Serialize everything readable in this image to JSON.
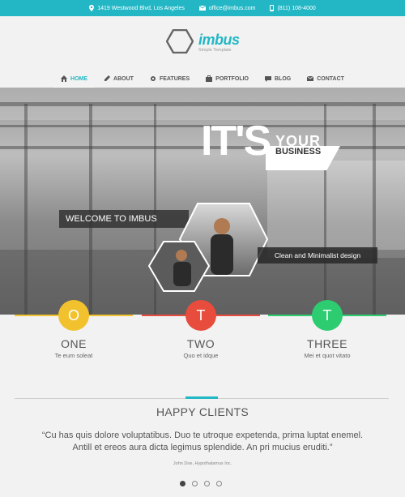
{
  "topbar": {
    "address": "1419 Westwood Blvd, Los Angeles",
    "email": "office@imbus.com",
    "phone": "(811) 108-4000"
  },
  "logo": {
    "title": "imbus",
    "subtitle": "Simple Template"
  },
  "nav": {
    "items": [
      {
        "label": "HOME",
        "icon": "home-icon"
      },
      {
        "label": "ABOUT",
        "icon": "pencil-icon"
      },
      {
        "label": "FEATURES",
        "icon": "gear-icon"
      },
      {
        "label": "PORTFOLIO",
        "icon": "briefcase-icon"
      },
      {
        "label": "BLOG",
        "icon": "comment-icon"
      },
      {
        "label": "CONTACT",
        "icon": "envelope-icon"
      }
    ]
  },
  "hero": {
    "title": "IT'S",
    "your": "YOUR",
    "business": "BUSINESS",
    "welcome": "WELCOME TO IMBUS",
    "tagline": "Clean and Minimalist design"
  },
  "features": [
    {
      "letter": "O",
      "title": "ONE",
      "subtitle": "Te eum soleat",
      "color": "#f2c12e"
    },
    {
      "letter": "T",
      "title": "TWO",
      "subtitle": "Quo et idque",
      "color": "#e74c3c"
    },
    {
      "letter": "T",
      "title": "THREE",
      "subtitle": "Mei et quot vitato",
      "color": "#2ecc71"
    }
  ],
  "clients": {
    "title": "HAPPY CLIENTS",
    "quote_line1": "“Cu has quis dolore voluptatibus. Duo te utroque expetenda, prima luptat enemel.",
    "quote_line2": "Antill et ereos aura dicta legimus splendide. An pri mucius eruditi.”",
    "author": "John Doe, Hypothalamus Inc."
  },
  "colors": {
    "accent": "#23b7c5"
  }
}
